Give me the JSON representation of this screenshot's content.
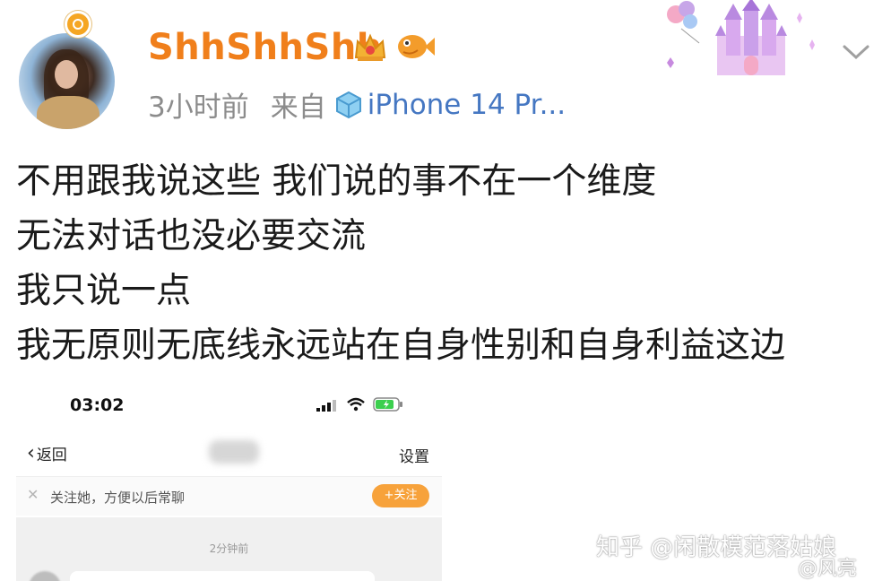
{
  "post": {
    "username": "ShhShhShh",
    "time": "3小时前",
    "from_label": "来自",
    "device": "iPhone 14 Pr...",
    "lines": [
      "不用跟我说这些 我们说的事不在一个维度",
      "无法对话也没必要交流",
      "我只说一点",
      "我无原则无底线永远站在自身性别和自身利益这边"
    ]
  },
  "icons": {
    "avatar_badge": "vip-badge-icon",
    "crown": "crown-icon",
    "fish": "fish-icon",
    "castle": "castle-icon",
    "chevron": "chevron-down-icon",
    "device": "cube-icon"
  },
  "screenshot": {
    "status_time": "03:02",
    "back_label": "返回",
    "settings_label": "设置",
    "follow_tip": "关注她，方便以后常聊",
    "follow_button": "+关注",
    "chat_time": "2分钟前"
  },
  "watermarks": {
    "zhihu": "知乎 @闲散模范落姑娘",
    "weibo": "@风亮"
  },
  "colors": {
    "username": "#f07f1b",
    "device_link": "#4577c2",
    "meta_gray": "#8c8c8c",
    "follow_button": "#f7a23b"
  }
}
